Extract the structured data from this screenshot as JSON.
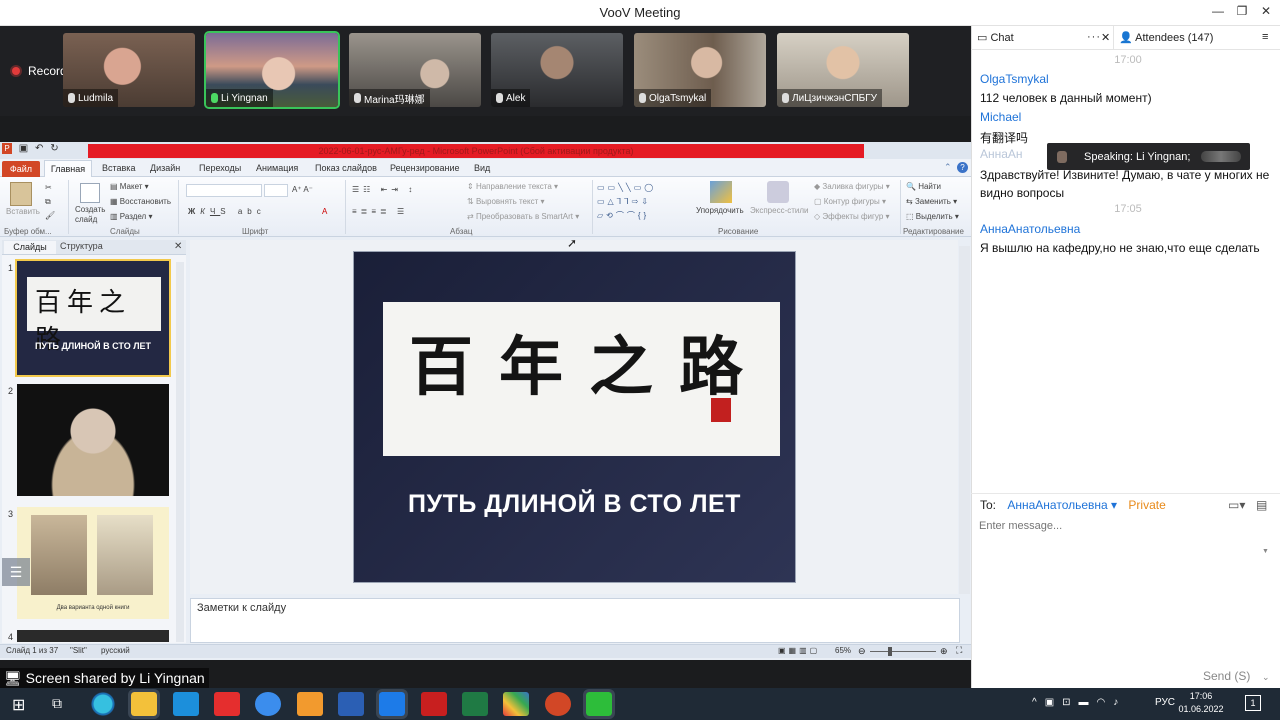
{
  "window": {
    "title": "VooV Meeting",
    "controls": [
      "—",
      "❐",
      "✕"
    ]
  },
  "meeting": {
    "recording_label": "Recording",
    "participants": [
      {
        "name": "Ludmila",
        "bg": "#8a6b5a",
        "mic": "off"
      },
      {
        "name": "Li Yingnan",
        "bg": "#6b6d8e",
        "mic": "on",
        "active": true
      },
      {
        "name": "Marina玛琳娜",
        "bg": "#6d6a66",
        "mic": "off"
      },
      {
        "name": "Alek",
        "bg": "#3e4044",
        "mic": "off"
      },
      {
        "name": "OlgaTsmykal",
        "bg": "#8a7c6c",
        "mic": "off"
      },
      {
        "name": "ЛиЦзичжэнСПБГУ",
        "bg": "#b7b0a4",
        "mic": "off"
      }
    ],
    "screen_shared_label": "Screen shared by Li Yingnan"
  },
  "ppt": {
    "title": "2022-06-01-рус-АМГу-ред - Microsoft PowerPoint (Сбой активации продукта)",
    "tabs": [
      "Файл",
      "Главная",
      "Вставка",
      "Дизайн",
      "Переходы",
      "Анимация",
      "Показ слайдов",
      "Рецензирование",
      "Вид"
    ],
    "ribbon": {
      "paste": "Вставить",
      "create_slide": "Создать слайд",
      "layout": "Макет",
      "restore": "Восстановить",
      "section": "Раздел",
      "text_direction": "Направление текста",
      "align_text": "Выровнять текст",
      "smartart": "Преобразовать в SmartArt",
      "arrange": "Упорядочить",
      "express_styles": "Экспресс-стили",
      "shape_fill": "Заливка фигуры",
      "shape_outline": "Контур фигуры",
      "shape_effects": "Эффекты фигур",
      "find": "Найти",
      "replace": "Заменить",
      "select": "Выделить",
      "groups": {
        "clipboard": "Буфер обм...",
        "slides": "Слайды",
        "font": "Шрифт",
        "paragraph": "Абзац",
        "drawing": "Рисование",
        "editing": "Редактирование"
      }
    },
    "panel_tabs": [
      "Слайды",
      "Структура"
    ],
    "thumbnails": [
      {
        "num": "1",
        "caption": "ПУТЬ ДЛИНОЙ В СТО ЛЕТ"
      },
      {
        "num": "2",
        "caption": ""
      },
      {
        "num": "3",
        "caption": "Два варианта одной книги"
      },
      {
        "num": "4",
        "caption": ""
      }
    ],
    "slide": {
      "calligraphy": "百年之路",
      "caption": "ПУТЬ ДЛИНОЙ В СТО ЛЕТ"
    },
    "notes_placeholder": "Заметки к слайду",
    "status": {
      "slide_of": "Слайд 1 из 37",
      "theme": "\"Slit\"",
      "language": "русский",
      "zoom": "65%"
    }
  },
  "chat": {
    "tab_chat": "Chat",
    "tab_attendees": "Attendees (147)",
    "messages": [
      {
        "time": "17:00"
      },
      {
        "name": "OlgaTsmykal",
        "text": "112 человек в данный момент)"
      },
      {
        "name": "Michael",
        "text": "有翻译吗"
      },
      {
        "name": "АннаАн",
        "text": "Здравствуйте! Извините! Думаю, в чате у многих не видно вопросы"
      },
      {
        "time": "17:05"
      },
      {
        "name": "АннаАнатольевна",
        "text": "Я вышлю на кафедру,но не знаю,что еще сделать"
      }
    ],
    "speaking_label": "Speaking: Li Yingnan;",
    "to_label": "To:",
    "recipient": "АннаАнатольевна",
    "private_label": "Private",
    "input_placeholder": "Enter message...",
    "send_label": "Send (S)"
  },
  "taskbar": {
    "language": "РУС",
    "time": "17:06",
    "date": "01.06.2022",
    "notification_count": "1"
  }
}
